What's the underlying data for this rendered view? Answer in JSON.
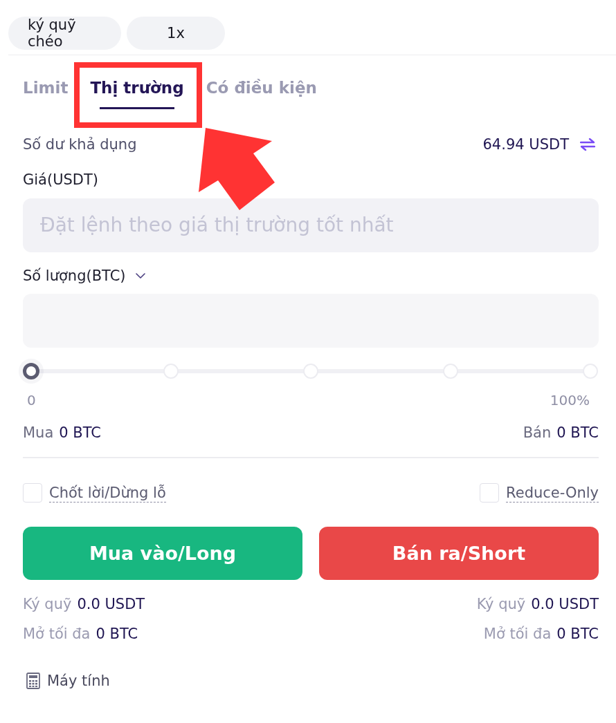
{
  "margin_controls": [
    {
      "label": "ký quỹ chéo"
    },
    {
      "label": "1x"
    }
  ],
  "order_tabs": [
    {
      "label": "Limit",
      "selected": false,
      "highlighted": false
    },
    {
      "label": "Thị trường",
      "selected": true,
      "highlighted": true
    },
    {
      "label": "Có điều kiện",
      "selected": false,
      "highlighted": false
    }
  ],
  "balance": {
    "label": "Số dư khả dụng",
    "value": "64.94 USDT"
  },
  "price": {
    "label": "Giá(USDT)",
    "placeholder": "Đặt lệnh theo giá thị trường tốt nhất"
  },
  "quantity": {
    "label": "Số lượng(BTC)"
  },
  "slider": {
    "level": 0,
    "min_label": "0",
    "max_label": "100%"
  },
  "estimates": [
    {
      "label": "Mua",
      "value": "0 BTC"
    },
    {
      "label": "Bán",
      "value": "0 BTC"
    }
  ],
  "options": [
    {
      "label": "Chốt lời/Dừng lỗ",
      "checked": false
    },
    {
      "label": "Reduce-Only",
      "checked": false
    }
  ],
  "actions": [
    {
      "label": "Mua vào/Long",
      "kind": "buy"
    },
    {
      "label": "Bán ra/Short",
      "kind": "sell"
    }
  ],
  "summary_rows": [
    {
      "items": [
        {
          "label": "Ký quỹ",
          "value": "0.0 USDT"
        },
        {
          "label": "Ký quỹ",
          "value": "0.0 USDT"
        }
      ]
    },
    {
      "items": [
        {
          "label": "Mở tối đa",
          "value": "0 BTC"
        },
        {
          "label": "Mở tối đa",
          "value": "0 BTC"
        }
      ]
    }
  ],
  "calculator": {
    "label": "Máy tính"
  }
}
